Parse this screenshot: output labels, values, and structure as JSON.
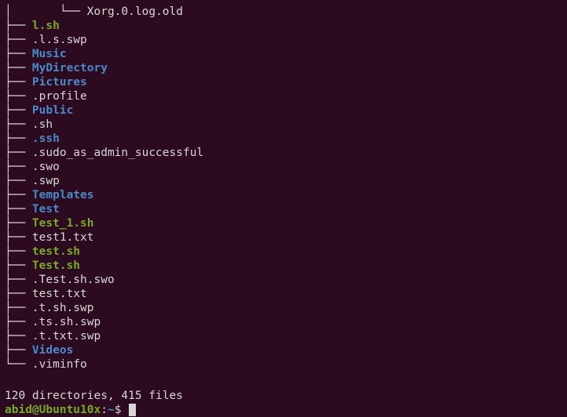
{
  "tree": {
    "nested_branch": "│       └── ",
    "nested_file": "Xorg.0.log.old",
    "branch": "├── ",
    "branch_last": "└── ",
    "entries": [
      {
        "name": "l.sh",
        "cls": "exec"
      },
      {
        "name": ".l.s.swp",
        "cls": "file"
      },
      {
        "name": "Music",
        "cls": "dir"
      },
      {
        "name": "MyDirectory",
        "cls": "dir"
      },
      {
        "name": "Pictures",
        "cls": "dir"
      },
      {
        "name": ".profile",
        "cls": "file"
      },
      {
        "name": "Public",
        "cls": "dir"
      },
      {
        "name": ".sh",
        "cls": "file"
      },
      {
        "name": ".ssh",
        "cls": "dir"
      },
      {
        "name": ".sudo_as_admin_successful",
        "cls": "file"
      },
      {
        "name": ".swo",
        "cls": "file"
      },
      {
        "name": ".swp",
        "cls": "file"
      },
      {
        "name": "Templates",
        "cls": "dir"
      },
      {
        "name": "Test",
        "cls": "dir"
      },
      {
        "name": "Test_1.sh",
        "cls": "exec"
      },
      {
        "name": "test1.txt",
        "cls": "file"
      },
      {
        "name": "test.sh",
        "cls": "exec"
      },
      {
        "name": "Test.sh",
        "cls": "exec"
      },
      {
        "name": ".Test.sh.swo",
        "cls": "file"
      },
      {
        "name": "test.txt",
        "cls": "file"
      },
      {
        "name": ".t.sh.swp",
        "cls": "file"
      },
      {
        "name": ".ts.sh.swp",
        "cls": "file"
      },
      {
        "name": ".t.txt.swp",
        "cls": "file"
      },
      {
        "name": "Videos",
        "cls": "dir"
      },
      {
        "name": ".viminfo",
        "cls": "file",
        "last": true
      }
    ]
  },
  "summary": "120 directories, 415 files",
  "prompt": {
    "user_host": "abid@Ubuntu10x",
    "colon": ":",
    "path": "~",
    "dollar": "$ "
  }
}
